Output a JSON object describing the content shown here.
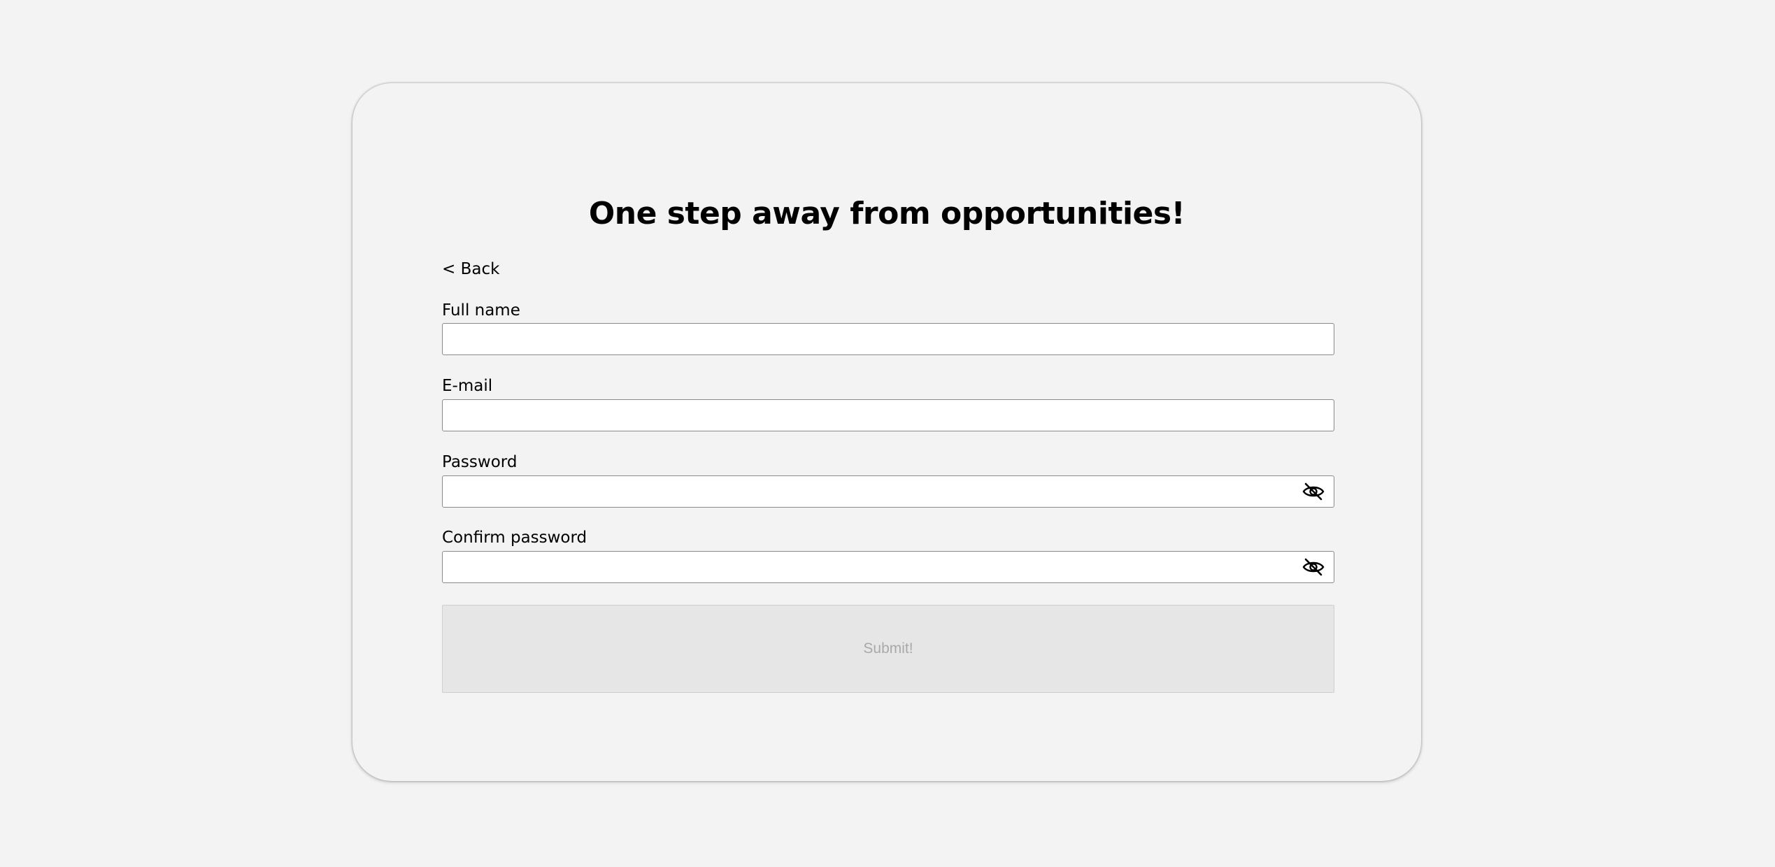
{
  "form": {
    "title": "One step away from opportunities!",
    "back_label": "< Back",
    "fields": [
      {
        "label": "Full name",
        "value": "",
        "type": "text"
      },
      {
        "label": "E-mail",
        "value": "",
        "type": "email"
      },
      {
        "label": "Password",
        "value": "",
        "type": "password",
        "toggle_icon": "eye-off-icon"
      },
      {
        "label": "Confirm password",
        "value": "",
        "type": "password",
        "toggle_icon": "eye-off-icon"
      }
    ],
    "submit_label": "Submit!",
    "submit_disabled": true
  },
  "colors": {
    "background": "#f3f3f3",
    "card": "#f3f3f3",
    "input_background": "#ffffff",
    "input_border": "#8a8a8a",
    "submit_background": "#e6e6e6",
    "submit_text": "#a9a9a9"
  }
}
